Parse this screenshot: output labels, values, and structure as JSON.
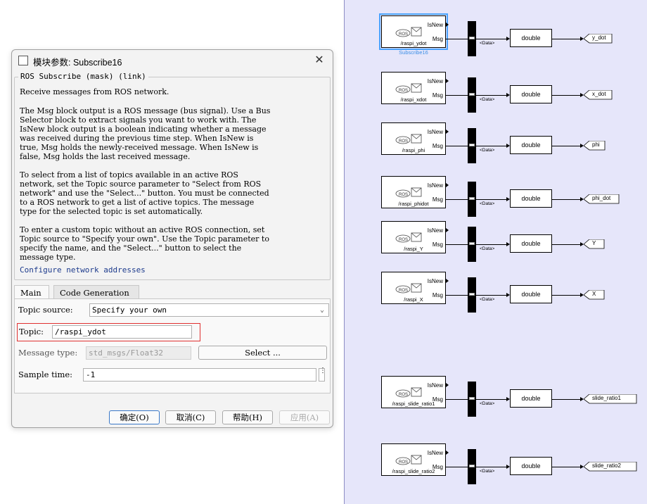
{
  "dialog": {
    "title": "模块参数: Subscribe16",
    "mask_title": "ROS Subscribe (mask) (link)",
    "desc": [
      "Receive messages from ROS network.",
      "The Msg block output is a ROS message (bus signal). Use a Bus\nSelector block to extract signals you want to work with. The\nIsNew block output is a boolean indicating whether a message\nwas received during the previous time step. When IsNew is\ntrue, Msg holds the newly-received message. When IsNew is\nfalse, Msg holds the last received message.",
      "To select from a list of topics available in an active ROS\nnetwork, set the Topic source parameter to \"Select from ROS\nnetwork\" and use the \"Select...\" button. You must be connected\nto a ROS network to get a list of active topics. The message\ntype for the selected topic is set automatically.",
      "To enter a custom topic without an active ROS connection, set\nTopic source to \"Specify your own\". Use the Topic parameter to\nspecify the name, and the \"Select...\" button to select the\nmessage type."
    ],
    "link": "Configure network addresses",
    "tabs": [
      "Main",
      "Code Generation"
    ],
    "form": {
      "topic_source_label": "Topic source:",
      "topic_source_value": "Specify your own",
      "topic_label": "Topic:",
      "topic_value": "/raspi_ydot",
      "message_type_label": "Message type:",
      "message_type_value": "std_msgs/Float32",
      "select_button": "Select ...",
      "sample_time_label": "Sample time:",
      "sample_time_value": "-1"
    },
    "buttons": {
      "ok": "确定(O)",
      "cancel": "取消(C)",
      "help": "帮助(H)",
      "apply": "应用(A)"
    }
  },
  "diagram": {
    "port_isnew": "IsNew",
    "port_msg": "Msg",
    "data_label": "<Data>",
    "conversion": "double",
    "selected_caption": "Subscribe16",
    "rows": [
      {
        "topic": "/raspi_ydot",
        "goto": "y_dot"
      },
      {
        "topic": "/raspi_xdot",
        "goto": "x_dot"
      },
      {
        "topic": "/raspi_phi",
        "goto": "phi"
      },
      {
        "topic": "/raspi_phidot",
        "goto": "phi_dot"
      },
      {
        "topic": "/raspi_Y",
        "goto": "Y"
      },
      {
        "topic": "/raspi_X",
        "goto": "X"
      },
      {
        "topic": "/raspi_slide_ratio1",
        "goto": "slide_ratio1"
      },
      {
        "topic": "/raspi_slide_ratio2",
        "goto": "slide_ratio2"
      }
    ]
  }
}
